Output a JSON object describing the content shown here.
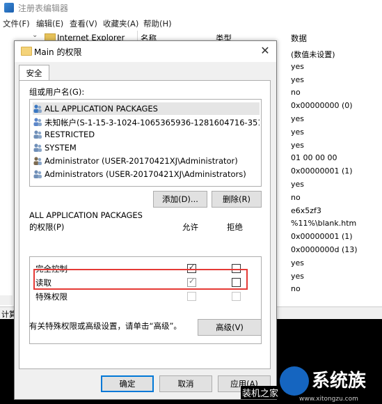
{
  "regedit": {
    "title": "注册表编辑器",
    "menu": [
      "文件(F)",
      "编辑(E)",
      "查看(V)",
      "收藏夹(A)",
      "帮助(H)"
    ],
    "tree_item": "Internet Explorer",
    "columns": {
      "name": "名称",
      "type": "类型",
      "data": "数据"
    },
    "values": [
      "(数值未设置)",
      "yes",
      "yes",
      "no",
      "0x00000000 (0)",
      "yes",
      "yes",
      "yes",
      "01 00 00 00",
      "0x00000001 (1)",
      "yes",
      "no",
      "e6x5zf3",
      "%11%\\blank.htm",
      "0x00000001 (1)",
      "0x0000000d (13)",
      "yes",
      "yes",
      "no"
    ],
    "status": "计算"
  },
  "dialog": {
    "title": "Main 的权限",
    "close_glyph": "✕",
    "tab": "安全",
    "group_label": "组或用户名(G):",
    "users": [
      {
        "text": "ALL APPLICATION PACKAGES",
        "icon": "app-packages-icon"
      },
      {
        "text": "未知帐户(S-1-15-3-1024-1065365936-1281604716-351173...",
        "icon": "unknown-account-icon"
      },
      {
        "text": "RESTRICTED",
        "icon": "group-icon"
      },
      {
        "text": "SYSTEM",
        "icon": "group-icon"
      },
      {
        "text": "Administrator (USER-20170421XJ\\Administrator)",
        "icon": "user-icon"
      },
      {
        "text": "Administrators (USER-20170421XJ\\Administrators)",
        "icon": "group-icon"
      }
    ],
    "add_button": "添加(D)...",
    "remove_button": "删除(R)",
    "perm_for_line1": "ALL APPLICATION PACKAGES",
    "perm_for_line2": "的权限(P)",
    "allow_header": "允许",
    "deny_header": "拒绝",
    "permissions": [
      {
        "name": "完全控制",
        "allow": true,
        "deny": false
      },
      {
        "name": "读取",
        "allow": true,
        "deny": false
      },
      {
        "name": "特殊权限",
        "allow": false,
        "deny": false
      }
    ],
    "advanced_note": "有关特殊权限或高级设置，请单击“高级”。",
    "advanced_button": "高级(V)",
    "ok_button": "确定",
    "cancel_button": "取消",
    "apply_button": "应用(A)"
  },
  "watermark": {
    "text1": "装机之家",
    "text2": "系统族",
    "url": "www.xitongzu.com"
  },
  "colors": {
    "highlight": "#e53935",
    "primary_border": "#0078d7"
  }
}
